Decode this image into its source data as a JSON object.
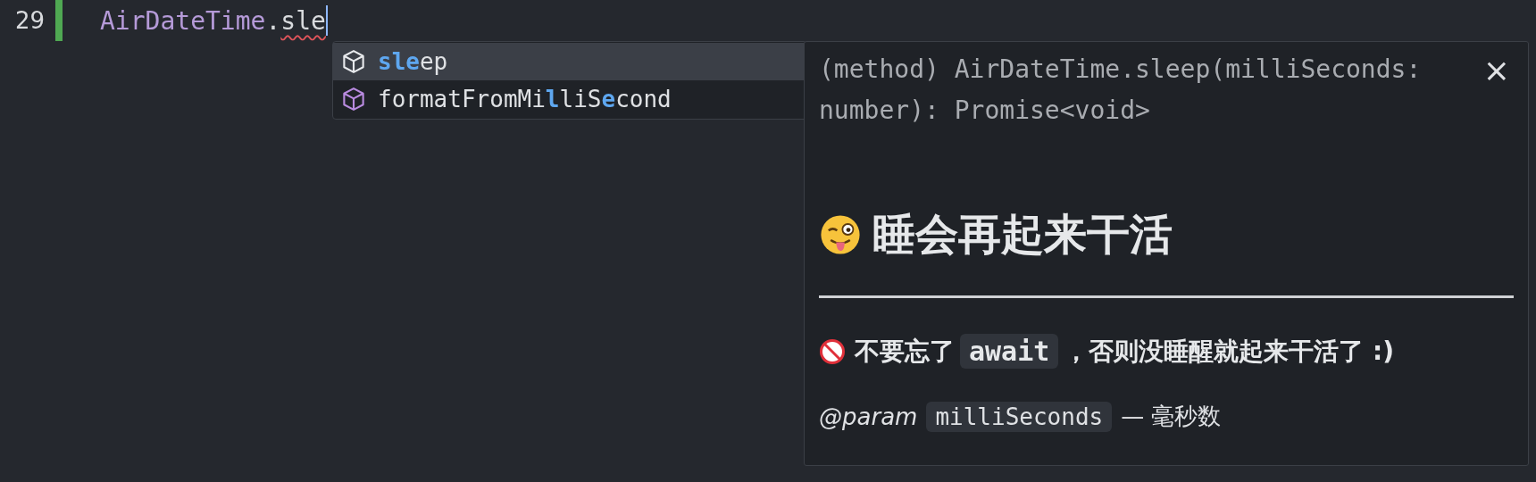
{
  "editor": {
    "line_number": "29",
    "code": [
      {
        "text": "AirDateTime",
        "kind": "class"
      },
      {
        "text": ".",
        "kind": "plain"
      },
      {
        "text": "sle",
        "kind": "error"
      }
    ]
  },
  "suggestions": [
    {
      "selected": true,
      "parts": [
        {
          "text": "sle",
          "match": true
        },
        {
          "text": "ep",
          "match": false
        }
      ]
    },
    {
      "selected": false,
      "parts": [
        {
          "text": "formatFromMi",
          "match": false
        },
        {
          "text": "l",
          "match": true
        },
        {
          "text": "liS",
          "match": false
        },
        {
          "text": "e",
          "match": true
        },
        {
          "text": "cond",
          "match": false
        }
      ]
    }
  ],
  "doc": {
    "signature": "(method) AirDateTime.sleep(milliSeconds: number): Promise<void>",
    "close": "×",
    "heading": "睡会再起来干活",
    "note": [
      {
        "text": "不要忘了",
        "kind": "text"
      },
      {
        "text": "await",
        "kind": "code"
      },
      {
        "text": "，否则没睡醒就起来干活了 :)",
        "kind": "text"
      }
    ],
    "param": [
      {
        "text": "@param",
        "kind": "tag"
      },
      {
        "text": "milliSeconds",
        "kind": "code"
      },
      {
        "text": "— 毫秒数",
        "kind": "text"
      }
    ]
  }
}
